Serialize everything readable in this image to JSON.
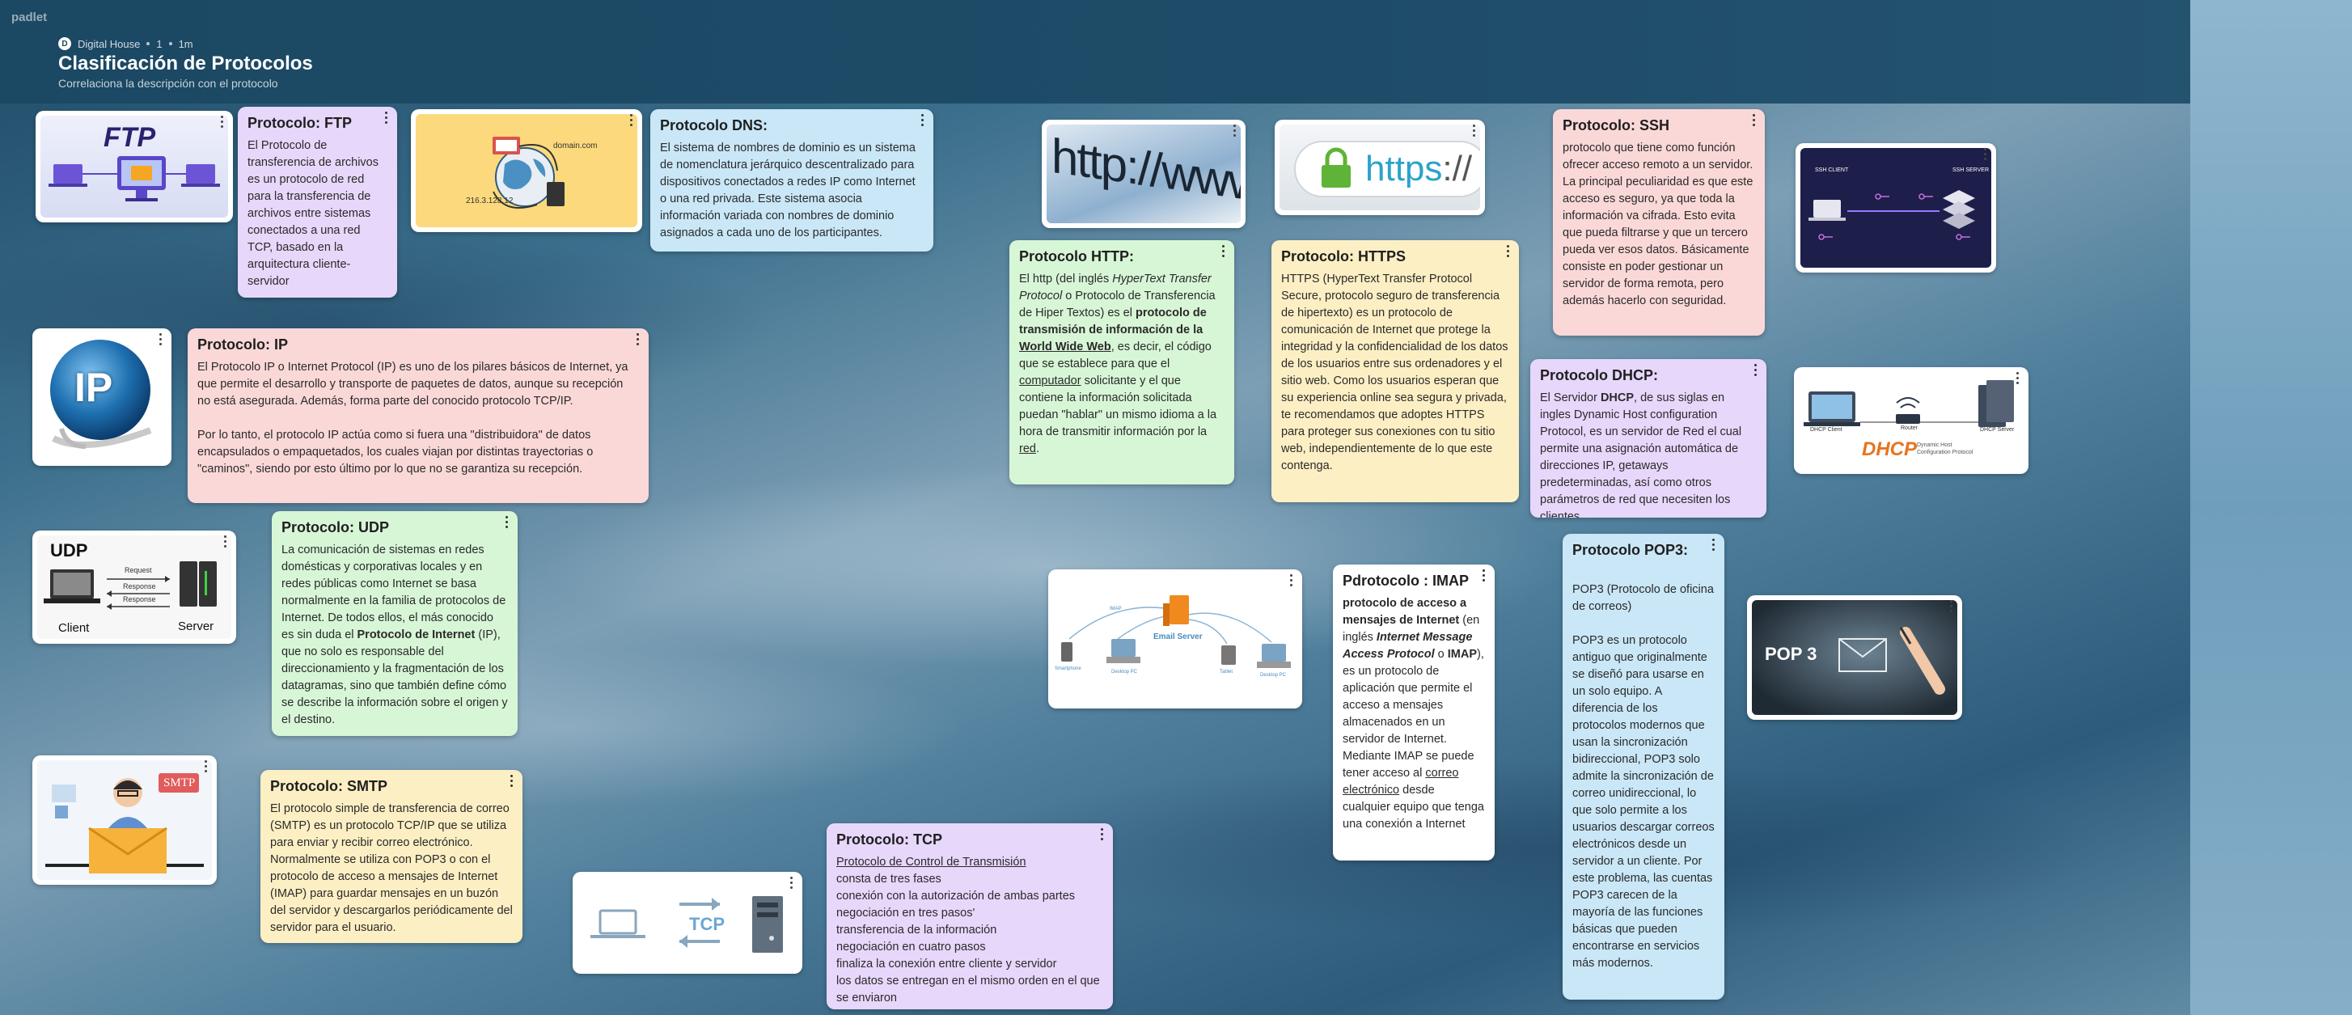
{
  "app": {
    "logo": "padlet"
  },
  "header": {
    "author": "Digital House",
    "avatar_letter": "D",
    "count": "1",
    "time": "1m",
    "title": "Clasificación de Protocolos",
    "subtitle": "Correlaciona la descripción con el protocolo"
  },
  "images": {
    "ftp": {
      "label": "FTP"
    },
    "dns": {
      "domain": "domain.com",
      "ip": "216.3.128.12"
    },
    "http": {
      "text": "http://www"
    },
    "https": {
      "text_a": "https",
      "text_b": "://"
    },
    "ssh": {
      "client": "SSH CLIENT",
      "server": "SSH SERVER"
    },
    "ip": {
      "label": "IP"
    },
    "dhcp": {
      "label": "DHCP",
      "client": "DHCP Client",
      "server": "DHCP Server",
      "router": "Router",
      "caption": "Dynamic Host Configuration Protocol"
    },
    "udp": {
      "title": "UDP",
      "request": "Request",
      "response1": "Response",
      "response2": "Response",
      "client": "Client",
      "server": "Server"
    },
    "imap": {
      "server": "Email Server",
      "devices": [
        "Smartphone",
        "Desktop PC",
        "Desktop PC",
        "Tablet",
        "Desktop PC"
      ],
      "link": "IMAP"
    },
    "pop3": {
      "label": "POP 3"
    },
    "smtp": {
      "label": "SMTP"
    },
    "tcp": {
      "label": "TCP"
    }
  },
  "cards": {
    "ftp": {
      "title": "Protocolo: FTP",
      "text": "El Protocolo de transferencia de archivos es un protocolo de red para la transferencia de archivos entre sistemas conectados a una red TCP, basado en la arquitectura cliente-servidor"
    },
    "dns": {
      "title": "Protocolo DNS:",
      "text": "El sistema de nombres de dominio  es un sistema de nomenclatura jerárquico descentralizado para dispositivos conectados a redes IP como Internet o una red privada. Este sistema asocia información variada con nombres de dominio asignados a cada uno de los participantes."
    },
    "ssh": {
      "title": "Protocolo: SSH",
      "text": "protocolo que tiene como función ofrecer acceso remoto a un servidor. La principal peculiaridad es que este acceso es seguro, ya que toda la información va cifrada. Esto evita que pueda filtrarse y que un tercero pueda ver esos datos. Básicamente consiste en poder gestionar un servidor de forma remota, pero además hacerlo con seguridad."
    },
    "ip": {
      "title": "Protocolo: IP",
      "text1": "El Protocolo IP o Internet Protocol (IP) es uno de los pilares básicos de Internet, ya que permite el desarrollo y transporte de paquetes de datos, aunque su recepción no está asegurada. Además, forma parte del conocido protocolo TCP/IP.",
      "text2": "Por lo tanto, el protocolo IP actúa como si fuera una \"distribuidora\" de datos encapsulados o empaquetados, los cuales viajan por distintas trayectorias o \"caminos\", siendo por esto último por lo que no se garantiza su recepción."
    },
    "http": {
      "title": "Protocolo HTTP:",
      "p1": "El http (del inglés ",
      "p2": "HyperText Transfer Protocol",
      "p3": " o Protocolo de Transferencia de Hiper Textos) es el ",
      "p4": "protocolo de transmisión de información de la ",
      "p5": "World Wide Web",
      "p6": ", es decir, el código que se establece para que el ",
      "p7": "computador",
      "p8": " solicitante y el que contiene la información solicitada puedan \"hablar\" un mismo idioma a la hora de transmitir información por la ",
      "p9": "red",
      "p10": "."
    },
    "https": {
      "title": "Protocolo: HTTPS",
      "text": "HTTPS (HyperText Transfer Protocol Secure, protocolo seguro de transferencia de hipertexto) es un protocolo de comunicación de Internet que protege la integridad y la confidencialidad de los datos de los usuarios entre sus ordenadores y el sitio web. Como los usuarios esperan que su experiencia online sea segura y privada, te recomendamos que adoptes HTTPS para proteger sus conexiones con tu sitio web, independientemente de lo que este contenga."
    },
    "dhcp": {
      "title": "Protocolo DHCP:",
      "p1": "El Servidor ",
      "p2": "DHCP",
      "p3": ", de sus siglas en ingles Dynamic Host configuration Protocol, es un servidor de Red el cual permite una asignación automática de direcciones IP, getaways predeterminadas, así como otros parámetros de red que necesiten los clientes."
    },
    "udp": {
      "title": "Protocolo: UDP",
      "p1": "La comunicación de sistemas en redes domésticas y corporativas locales y en redes públicas como Internet se basa normalmente en la familia de protocolos de Internet. De todos ellos, el más conocido es sin duda el ",
      "p2": "Protocolo de Internet",
      "p3": " (IP), que no solo es responsable del direccionamiento y la fragmentación de los datagramas, sino que también define cómo se describe la información sobre el origen y el destino."
    },
    "imap": {
      "title": "Pdrotocolo : IMAP",
      "p1": " protocolo de acceso a mensajes de Internet",
      "p2": " (en inglés ",
      "p3": "Internet Message Access Protocol",
      "p4": " o ",
      "p5": "IMAP",
      "p6": "), es un protocolo de aplicación que permite el acceso a mensajes almacenados en un servidor de Internet. Mediante IMAP se puede tener acceso al ",
      "p7": "correo electrónico",
      "p8": " desde cualquier equipo que tenga una conexión a Internet"
    },
    "pop3": {
      "title": "Protocolo POP3:",
      "text1": "POP3 (Protocolo de oficina de correos)",
      "text2": "POP3 es un protocolo antiguo que originalmente se diseñó para usarse en un solo equipo. A diferencia de los protocolos modernos que usan la sincronización bidireccional, POP3 solo admite la sincronización de correo unidireccional, lo que solo permite a los usuarios descargar correos electrónicos desde un servidor a un cliente. Por este problema, las cuentas POP3 carecen de la mayoría de las funciones básicas que pueden encontrarse en servicios más modernos."
    },
    "smtp": {
      "title": "Protocolo: SMTP",
      "text": "El protocolo simple de transferencia de correo (SMTP) es un protocolo TCP/IP que se utiliza para enviar y recibir correo electrónico. Normalmente se utiliza con POP3 o con el protocolo de acceso a mensajes de Internet (IMAP) para guardar mensajes en un buzón del servidor y descargarlos periódicamente del servidor para el usuario."
    },
    "tcp": {
      "title": "Protocolo: TCP",
      "lines": [
        "Protocolo de Control de Transmisión",
        "consta de tres fases",
        "conexión con la autorización de ambas partes",
        "negociación en tres pasos'",
        "transferencia de la información",
        "negociación en cuatro pasos",
        "finaliza la conexión entre cliente y servidor",
        "los datos se entregan en el mismo orden en el que se enviaron"
      ]
    }
  }
}
